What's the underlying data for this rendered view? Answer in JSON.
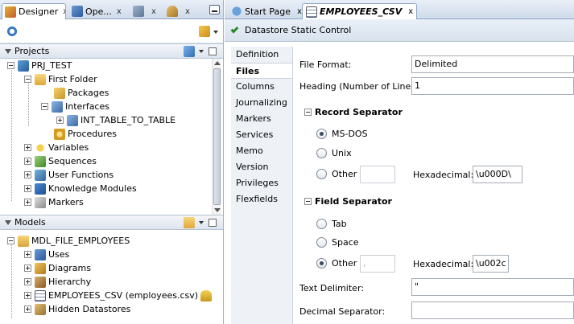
{
  "left_tabs": [
    {
      "label": "Designer",
      "close": "x"
    },
    {
      "label": "Ope...",
      "close": "x"
    },
    {
      "label": "",
      "close": "x"
    },
    {
      "label": "",
      "close": "x"
    }
  ],
  "projects": {
    "title": "Projects",
    "tree": [
      {
        "label": "PRJ_TEST"
      },
      {
        "label": "First Folder"
      },
      {
        "label": "Packages"
      },
      {
        "label": "Interfaces"
      },
      {
        "label": "INT_TABLE_TO_TABLE"
      },
      {
        "label": "Procedures"
      },
      {
        "label": "Variables"
      },
      {
        "label": "Sequences"
      },
      {
        "label": "User Functions"
      },
      {
        "label": "Knowledge Modules"
      },
      {
        "label": "Markers"
      }
    ]
  },
  "models": {
    "title": "Models",
    "tree": [
      {
        "label": "MDL_FILE_EMPLOYEES"
      },
      {
        "label": "Uses"
      },
      {
        "label": "Diagrams"
      },
      {
        "label": "Hierarchy"
      },
      {
        "label": "EMPLOYEES_CSV (employees.csv)"
      },
      {
        "label": "Hidden Datastores"
      }
    ]
  },
  "right_tabs": [
    {
      "label": "Start Page",
      "close": "x"
    },
    {
      "label": "EMPLOYEES_CSV",
      "close": "x"
    }
  ],
  "control_bar": {
    "label": "Datastore Static Control"
  },
  "nav": [
    "Definition",
    "Files",
    "Columns",
    "Journalizing",
    "Markers",
    "Services",
    "Memo",
    "Version",
    "Privileges",
    "Flexfields"
  ],
  "form": {
    "file_format_label": "File Format:",
    "file_format_value": "Delimited",
    "heading_label": "Heading (Number of Lines):",
    "heading_value": "1",
    "record_separator": {
      "title": "Record Separator",
      "ms_dos": "MS-DOS",
      "unix": "Unix",
      "other": "Other",
      "other_value": "",
      "hex_label": "Hexadecimal:",
      "hex_value": "\\u000D\\"
    },
    "field_separator": {
      "title": "Field Separator",
      "tab": "Tab",
      "space": "Space",
      "other": "Other",
      "other_value": ",",
      "hex_label": "Hexadecimal:",
      "hex_value": "\\u002c"
    },
    "text_delimiter_label": "Text Delimiter:",
    "text_delimiter_value": "\"",
    "decimal_separator_label": "Decimal Separator:",
    "decimal_separator_value": ""
  }
}
